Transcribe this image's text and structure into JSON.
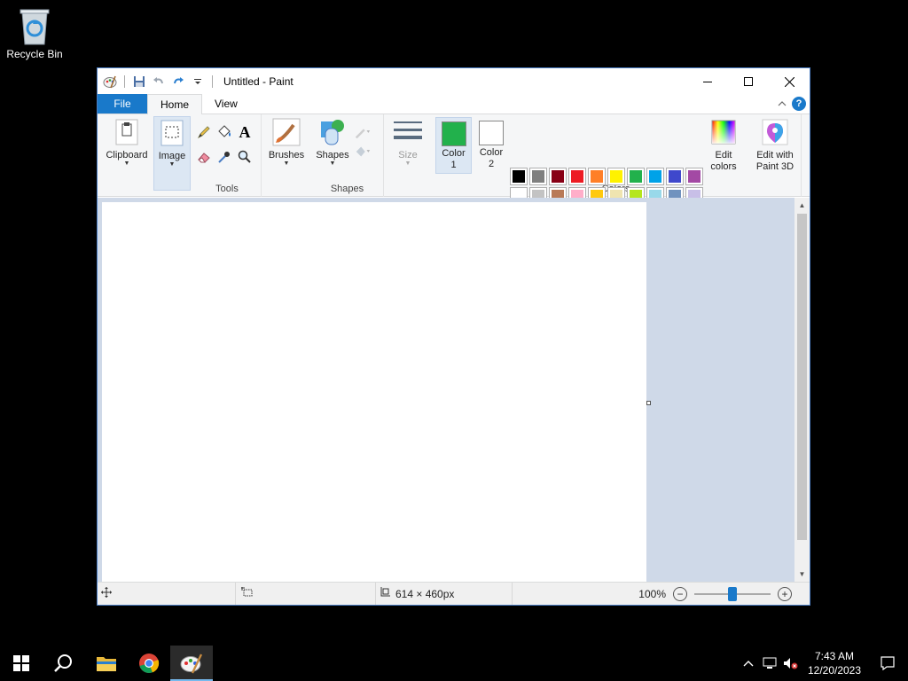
{
  "desktop": {
    "recycle_bin_label": "Recycle Bin"
  },
  "window": {
    "title": "Untitled - Paint"
  },
  "tabs": {
    "file": "File",
    "home": "Home",
    "view": "View"
  },
  "ribbon": {
    "clipboard_label": "Clipboard",
    "image_label": "Image",
    "tools_group": "Tools",
    "brushes_label": "Brushes",
    "shapes_label": "Shapes",
    "shapes_group": "Shapes",
    "size_label": "Size",
    "color1_label": "Color\n1",
    "color2_label": "Color\n2",
    "colors_group": "Colors",
    "edit_colors_label": "Edit\ncolors",
    "paint3d_label": "Edit with\nPaint 3D",
    "color1": "#22b14c",
    "color2": "#ffffff"
  },
  "palette": {
    "row1": [
      "#000000",
      "#7f7f7f",
      "#880015",
      "#ed1c24",
      "#ff7f27",
      "#fff200",
      "#22b14c",
      "#00a2e8",
      "#3f48cc",
      "#a349a4"
    ],
    "row2": [
      "#ffffff",
      "#c3c3c3",
      "#b97a57",
      "#ffaec9",
      "#ffc90e",
      "#efe4b0",
      "#b5e61d",
      "#99d9ea",
      "#7092be",
      "#c8bfe7"
    ]
  },
  "status": {
    "dimensions": "614 × 460px",
    "zoom": "100%",
    "zoom_fraction": 0.5
  },
  "taskbar": {
    "time": "7:43 AM",
    "date": "12/20/2023"
  }
}
